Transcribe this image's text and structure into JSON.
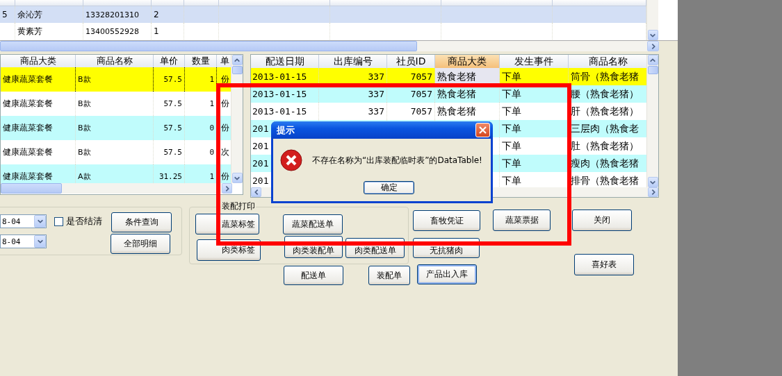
{
  "top_table": {
    "rows": [
      {
        "selected": true,
        "cells": [
          "5",
          "余沁芳",
          "13328201310",
          "2"
        ]
      },
      {
        "selected": false,
        "cells": [
          "",
          "黄素芳",
          "13400552928",
          "1"
        ]
      }
    ]
  },
  "order_table": {
    "columns": [
      "商品大类",
      "商品名称",
      "单价",
      "数量",
      "单"
    ],
    "rows": [
      {
        "selected": true,
        "cells": [
          "健康蔬菜套餐",
          "B款",
          "57.5",
          "1",
          "份"
        ]
      },
      {
        "selected": false,
        "cells": [
          "健康蔬菜套餐",
          "B款",
          "57.5",
          "1",
          "份"
        ]
      },
      {
        "selected": false,
        "cells": [
          "健康蔬菜套餐",
          "B款",
          "57.5",
          "0",
          "份"
        ]
      },
      {
        "selected": false,
        "cells": [
          "健康蔬菜套餐",
          "B款",
          "57.5",
          "0",
          "次"
        ]
      },
      {
        "selected": false,
        "cells": [
          "健康蔬菜套餐",
          "A款",
          "31.25",
          "1",
          "份"
        ]
      }
    ]
  },
  "delivery_table": {
    "columns": [
      {
        "label": "配送日期",
        "selected": false
      },
      {
        "label": "出库编号",
        "selected": false
      },
      {
        "label": "社员ID",
        "selected": false
      },
      {
        "label": "商品大类",
        "selected": true
      },
      {
        "label": "发生事件",
        "selected": false
      },
      {
        "label": "商品名称",
        "selected": false
      }
    ],
    "rows": [
      {
        "selected": true,
        "cells": [
          "2013-01-15",
          "337",
          "7057",
          "熟食老猪",
          "下单",
          "筒骨（熟食老猪"
        ]
      },
      {
        "selected": false,
        "cells": [
          "2013-01-15",
          "337",
          "7057",
          "熟食老猪",
          "下单",
          "腰（熟食老猪）"
        ]
      },
      {
        "selected": false,
        "cells": [
          "2013-01-15",
          "337",
          "7057",
          "熟食老猪",
          "下单",
          "肝（熟食老猪）"
        ]
      },
      {
        "selected": false,
        "cells": [
          "201",
          "",
          "",
          "",
          "下单",
          "三层肉（熟食老"
        ]
      },
      {
        "selected": false,
        "cells": [
          "201",
          "",
          "",
          "",
          "下单",
          "肚（熟食老猪）"
        ]
      },
      {
        "selected": false,
        "cells": [
          "201",
          "",
          "",
          "",
          "下单",
          "瘦肉（熟食老猪"
        ]
      },
      {
        "selected": false,
        "cells": [
          "201",
          "",
          "",
          "",
          "下单",
          "排骨（熟食老猪"
        ]
      }
    ]
  },
  "filters": {
    "date_from": "8-04",
    "date_to": "8-04",
    "settled": {
      "label": "是否结清",
      "checked": false
    }
  },
  "print_group": {
    "title": "装配打印"
  },
  "buttons": [
    {
      "label": "条件查询",
      "focused": false
    },
    {
      "label": "全部明细",
      "focused": false
    },
    {
      "label": "蔬菜标签",
      "focused": false
    },
    {
      "label": "肉类标签",
      "focused": false
    },
    {
      "label": "蔬菜配送单",
      "focused": false
    },
    {
      "label": "肉类装配单",
      "focused": false
    },
    {
      "label": "肉类配送单",
      "focused": false
    },
    {
      "label": "配送单",
      "focused": false
    },
    {
      "label": "装配单",
      "focused": false
    },
    {
      "label": "畜牧凭证",
      "focused": false
    },
    {
      "label": "无抗猪肉",
      "focused": false
    },
    {
      "label": "产品出入库",
      "focused": true
    },
    {
      "label": "蔬菜票据",
      "focused": false
    },
    {
      "label": "关闭",
      "focused": false
    },
    {
      "label": "喜好表",
      "focused": false
    }
  ],
  "dialog": {
    "title": "提示",
    "message": "不存在名称为“出库装配临时表”的DataTable!",
    "button": "确定"
  }
}
